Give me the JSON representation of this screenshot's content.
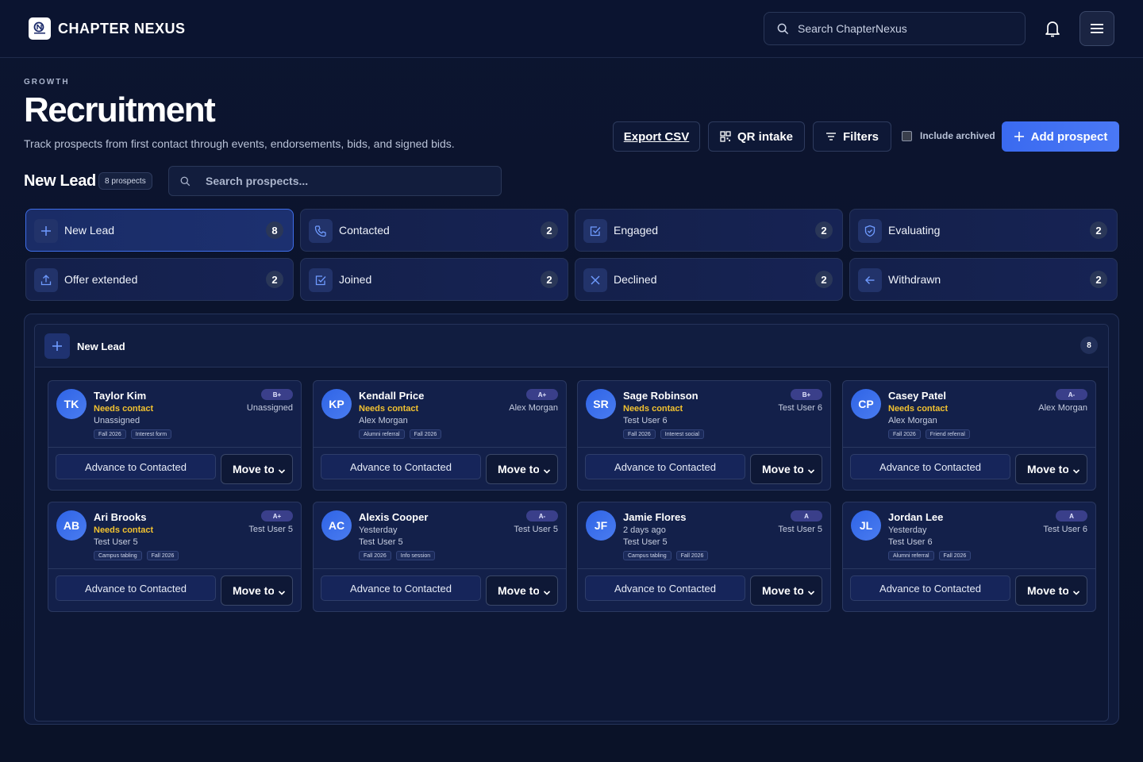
{
  "app": {
    "logo_text": "CHAPTER NEXUS",
    "search_placeholder": "Search ChapterNexus"
  },
  "header": {
    "eyebrow": "GROWTH",
    "title": "Recruitment",
    "subtitle": "Track prospects from first contact through events, endorsements, bids, and signed bids.",
    "export_label": "Export CSV",
    "qr_label": "QR intake",
    "filters_label": "Filters",
    "archived_label": "Include archived",
    "add_label": "Add prospect"
  },
  "stage": {
    "title": "New Lead",
    "count_label": "8 prospects",
    "search_placeholder": "Search prospects..."
  },
  "stages": [
    {
      "label": "New Lead",
      "count": "8",
      "icon": "plus-icon",
      "active": true
    },
    {
      "label": "Contacted",
      "count": "2",
      "icon": "phone-icon",
      "active": false
    },
    {
      "label": "Engaged",
      "count": "2",
      "icon": "check-square-icon",
      "active": false
    },
    {
      "label": "Evaluating",
      "count": "2",
      "icon": "shield-check-icon",
      "active": false
    },
    {
      "label": "Offer extended",
      "count": "2",
      "icon": "upload-icon",
      "active": false
    },
    {
      "label": "Joined",
      "count": "2",
      "icon": "check-square-icon",
      "active": false
    },
    {
      "label": "Declined",
      "count": "2",
      "icon": "x-icon",
      "active": false
    },
    {
      "label": "Withdrawn",
      "count": "2",
      "icon": "arrow-left-icon",
      "active": false
    }
  ],
  "board": {
    "title": "New Lead",
    "count": "8",
    "advance_label": "Advance to Contacted",
    "move_label": "Move to"
  },
  "prospects": [
    {
      "initials": "TK",
      "name": "Taylor Kim",
      "status": "Needs contact",
      "highlight": true,
      "owner": "Unassigned",
      "assignee": "Unassigned",
      "grade": "B+",
      "tags": [
        "Fall 2026",
        "Interest form"
      ]
    },
    {
      "initials": "KP",
      "name": "Kendall Price",
      "status": "Needs contact",
      "highlight": true,
      "owner": "Alex Morgan",
      "assignee": "Alex Morgan",
      "grade": "A+",
      "tags": [
        "Alumni referral",
        "Fall 2026"
      ]
    },
    {
      "initials": "SR",
      "name": "Sage Robinson",
      "status": "Needs contact",
      "highlight": true,
      "owner": "Test User 6",
      "assignee": "Test User 6",
      "grade": "B+",
      "tags": [
        "Fall 2026",
        "Interest social"
      ]
    },
    {
      "initials": "CP",
      "name": "Casey Patel",
      "status": "Needs contact",
      "highlight": true,
      "owner": "Alex Morgan",
      "assignee": "Alex Morgan",
      "grade": "A-",
      "tags": [
        "Fall 2026",
        "Friend referral"
      ]
    },
    {
      "initials": "AB",
      "name": "Ari Brooks",
      "status": "Needs contact",
      "highlight": true,
      "owner": "Test User 5",
      "assignee": "Test User 5",
      "grade": "A+",
      "tags": [
        "Campus tabling",
        "Fall 2026"
      ]
    },
    {
      "initials": "AC",
      "name": "Alexis Cooper",
      "status": "Yesterday",
      "highlight": false,
      "owner": "Test User 5",
      "assignee": "Test User 5",
      "grade": "A-",
      "tags": [
        "Fall 2026",
        "Info session"
      ]
    },
    {
      "initials": "JF",
      "name": "Jamie Flores",
      "status": "2 days ago",
      "highlight": false,
      "owner": "Test User 5",
      "assignee": "Test User 5",
      "grade": "A",
      "tags": [
        "Campus tabling",
        "Fall 2026"
      ]
    },
    {
      "initials": "JL",
      "name": "Jordan Lee",
      "status": "Yesterday",
      "highlight": false,
      "owner": "Test User 6",
      "assignee": "Test User 6",
      "grade": "A",
      "tags": [
        "Alumni referral",
        "Fall 2026"
      ]
    }
  ],
  "colors": {
    "accent": "#3a6af0",
    "highlight_status": "#f2c230",
    "background": "#0c1530"
  }
}
